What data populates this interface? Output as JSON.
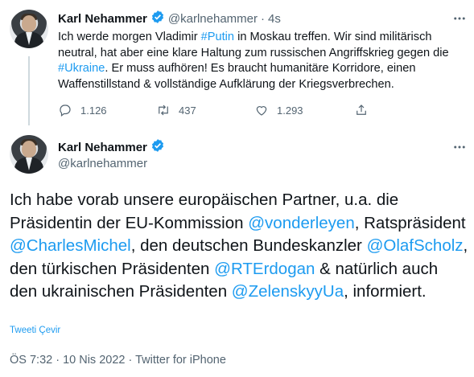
{
  "colors": {
    "link": "#1d9bf0",
    "muted": "#536471",
    "verified": "#1d9bf0",
    "thread_line": "#cfd9de"
  },
  "tweet1": {
    "author_name": "Karl Nehammer",
    "author_handle": "@karlnehammer",
    "separator": "·",
    "time": "4s",
    "text_parts": [
      "Ich werde morgen Vladimir ",
      "#Putin",
      " in Moskau treffen. Wir sind militärisch neutral, hat aber eine klare Haltung zum russischen Angriffskrieg gegen die ",
      "#Ukraine",
      ". Er muss aufhören! Es braucht humanitäre Korridore, einen Waffenstillstand & vollständige Aufklärung der Kriegsverbrechen."
    ],
    "replies": "1.126",
    "retweets": "437",
    "likes": "1.293",
    "icons": [
      "reply-icon",
      "retweet-icon",
      "like-icon",
      "share-icon",
      "more-icon",
      "verified-icon"
    ]
  },
  "tweet2": {
    "author_name": "Karl Nehammer",
    "author_handle": "@karlnehammer",
    "text_parts": [
      "Ich habe vorab unsere europäischen Partner, u.a. die Präsidentin der EU-Kommission ",
      "@vonderleyen",
      ", Ratspräsident ",
      "@CharlesMichel",
      ", den deutschen Bundeskanzler ",
      "@OlafScholz",
      ", den türkischen Präsidenten ",
      "@RTErdogan",
      " & natürlich auch den ukrainischen Präsidenten ",
      "@ZelenskyyUa",
      ", informiert."
    ],
    "translate_label": "Tweeti Çevir",
    "timestamp": "ÖS 7:32 · 10 Nis 2022 · Twitter for iPhone"
  }
}
